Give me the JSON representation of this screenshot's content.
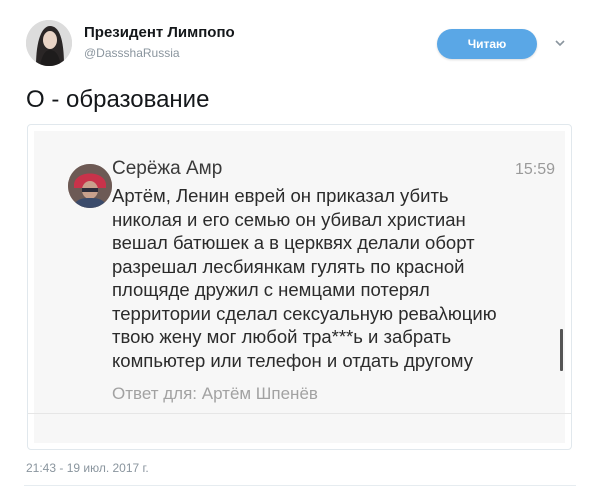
{
  "author": {
    "name": "Президент Лимпопо",
    "handle": "@DassshaRussia"
  },
  "follow_button": {
    "label": "Читаю"
  },
  "icons": {
    "more": "chevron-down-icon"
  },
  "tweet_text": "О - образование",
  "embedded_message": {
    "sender": "Серёжа Амр",
    "time": "15:59",
    "body": "Артём, Ленин еврей он приказал убить\nниколая и его семью он убивал христиан\nвешал батюшек а в церквях делали оборт\nразрешал лесбиянкам гулять по красной\nплощяде дружил с немцами потерял\nтерритории сделал сексуальную реваλюцию\nтвою жену мог любой тра***ь и забрать\nкомпьютер или телефон и отдать другому",
    "reply_to": "Ответ для: Артём Шпенёв"
  },
  "timestamp": "21:43 - 19 июл. 2017 г.",
  "colors": {
    "follow_button": "#5aa7e6",
    "secondary_text": "#8a959e"
  }
}
